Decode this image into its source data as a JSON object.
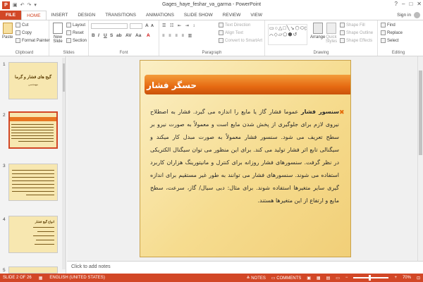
{
  "window": {
    "title": "Gages_haye_feshar_va_garma - PowerPoint",
    "app_icon_letter": "P",
    "controls": [
      "?",
      "–",
      "□",
      "✕"
    ]
  },
  "tabs": [
    "FILE",
    "HOME",
    "INSERT",
    "DESIGN",
    "TRANSITIONS",
    "ANIMATIONS",
    "SLIDE SHOW",
    "REVIEW",
    "VIEW"
  ],
  "active_tab": "HOME",
  "user": {
    "signin": "Sign in"
  },
  "ribbon": {
    "clipboard": {
      "label": "Clipboard",
      "paste": "Paste",
      "cut": "Cut",
      "copy": "Copy",
      "format_painter": "Format Painter"
    },
    "slides": {
      "label": "Slides",
      "new_slide": "New Slide",
      "layout": "Layout",
      "reset": "Reset",
      "section": "Section"
    },
    "font": {
      "label": "Font"
    },
    "paragraph": {
      "label": "Paragraph",
      "text_direction": "Text Direction",
      "align_text": "Align Text",
      "convert_smartart": "Convert to SmartArt"
    },
    "drawing": {
      "label": "Drawing",
      "arrange": "Arrange",
      "quick_styles": "Quick Styles",
      "shape_fill": "Shape Fill",
      "shape_outline": "Shape Outline",
      "shape_effects": "Shape Effects"
    },
    "editing": {
      "label": "Editing",
      "find": "Find",
      "replace": "Replace",
      "select": "Select"
    }
  },
  "thumbnails": [
    {
      "num": "1",
      "title": "گیج های فشار و گرما",
      "subtitle": "مهندسی"
    },
    {
      "num": "2",
      "title": "حسگر فشار"
    },
    {
      "num": "3"
    },
    {
      "num": "4",
      "title": "انواع گیج فشار"
    },
    {
      "num": "5"
    }
  ],
  "slide": {
    "title": "حسگر فشار",
    "body_bold": "سنسور فشار",
    "body": " عموما فشار گاز یا مایع را اندازه می گیرد. فشار به اصطلاح نیروی لازم برای جلوگیری از پخش شدن مایع است و معمولاً به صورت نیرو بر سطح تعریف می شود. سنسور فشار معمولاً به صورت مبدل کار میکند و سیگنالی تابع اثر فشار تولید می کند. برای این منظور می توان سیگنال الکتریکی در نظر گرفت. سنسورهای فشار روزانه برای کنترل و مانیتورینگ هزاران کاربرد استفاده می شوند. سنسورهای فشار می توانند به طور غیر مستقیم برای اندازه گیری سایر متغیرها استفاده شوند. برای مثال: دبی سیال/ گاز، سرعت، سطح مایع و ارتفاع از این متغیرها هستند."
  },
  "notes_placeholder": "Click to add notes",
  "status": {
    "slide_of": "SLIDE 2 OF 26",
    "language": "ENGLISH (UNITED STATES)",
    "notes": "NOTES",
    "comments": "COMMENTS",
    "zoom": "70%"
  },
  "colors": {
    "accent": "#d24726",
    "slide_bg": "#f6dc8f",
    "banner": "#e66a12"
  }
}
